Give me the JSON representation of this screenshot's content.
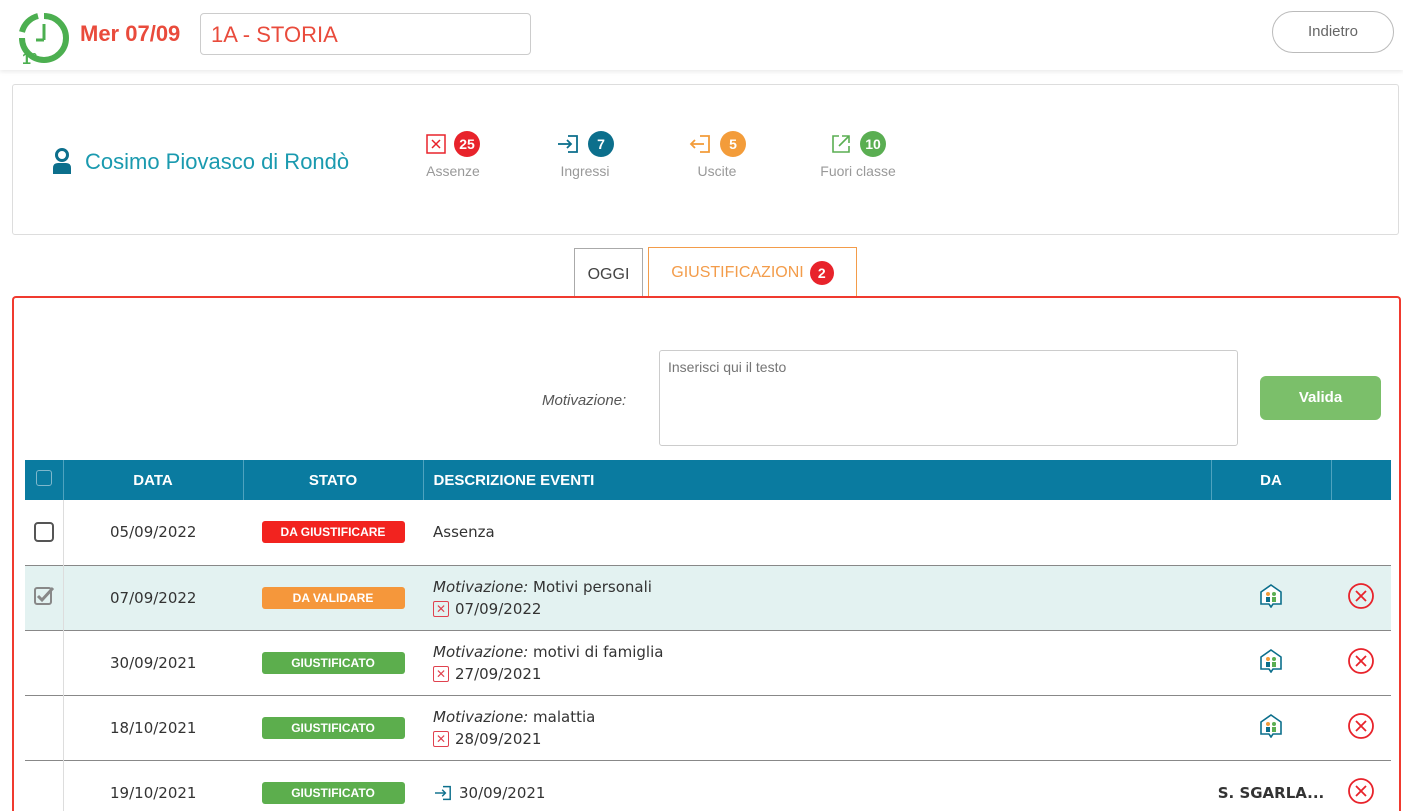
{
  "header": {
    "clock_label": "1°",
    "date": "Mer 07/09",
    "class": "1A - STORIA",
    "back_label": "Indietro"
  },
  "student": {
    "name": "Cosimo Piovasco di Rondò",
    "stats": [
      {
        "label": "Assenze",
        "count": "25",
        "icon": "absence-x-icon",
        "color": "#e8232b"
      },
      {
        "label": "Ingressi",
        "count": "7",
        "icon": "entry-arrow-icon",
        "color": "#0c6f8c"
      },
      {
        "label": "Uscite",
        "count": "5",
        "icon": "exit-arrow-icon",
        "color": "#f39c3a"
      },
      {
        "label": "Fuori classe",
        "count": "10",
        "icon": "external-link-icon",
        "color": "#5aae52"
      }
    ]
  },
  "tabs": {
    "oggi": "OGGI",
    "giustificazioni": "GIUSTIFICAZIONI",
    "giustificazioni_count": "2"
  },
  "form": {
    "motivazione_label": "Motivazione:",
    "motivazione_placeholder": "Inserisci qui il testo",
    "valida_label": "Valida"
  },
  "table": {
    "headers": [
      "DATA",
      "STATO",
      "DESCRIZIONE EVENTI",
      "DA"
    ],
    "rows": [
      {
        "date": "05/09/2022",
        "status": "DA GIUSTIFICARE",
        "status_color": "#f2231f",
        "desc_plain": "Assenza",
        "checked": false
      },
      {
        "date": "07/09/2022",
        "status": "DA VALIDARE",
        "status_color": "#f5973b",
        "motiv_prefix": "Motivazione:",
        "motiv": "Motivi personali",
        "event_date": "07/09/2022",
        "checked": true
      },
      {
        "date": "30/09/2021",
        "status": "GIUSTIFICATO",
        "status_color": "#5cae4d",
        "motiv_prefix": "Motivazione:",
        "motiv": "motivi di famiglia",
        "event_date": "27/09/2021"
      },
      {
        "date": "18/10/2021",
        "status": "GIUSTIFICATO",
        "status_color": "#5cae4d",
        "motiv_prefix": "Motivazione:",
        "motiv": "malattia",
        "event_date": "28/09/2021"
      },
      {
        "date": "19/10/2021",
        "status": "GIUSTIFICATO",
        "status_color": "#5cae4d",
        "event_date": "30/09/2021",
        "da": "S. SGARLA..."
      }
    ]
  }
}
